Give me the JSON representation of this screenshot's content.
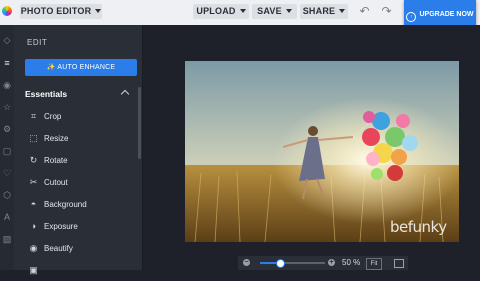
{
  "header": {
    "app_menu_label": "PHOTO EDITOR",
    "upload_label": "UPLOAD",
    "save_label": "SAVE",
    "share_label": "SHARE",
    "upgrade_label": "UPGRADE NOW",
    "undo_icon": "undo-icon",
    "redo_icon": "redo-icon"
  },
  "sidebar_rail": {
    "icons": [
      "layers-icon",
      "adjust-sliders-icon",
      "eye-icon",
      "star-icon",
      "gear-icon",
      "frame-icon",
      "heart-icon",
      "hexagon-icon",
      "text-icon",
      "texture-icon"
    ]
  },
  "panel": {
    "title": "EDIT",
    "auto_enhance_label": "AUTO ENHANCE",
    "section_title": "Essentials",
    "items": [
      {
        "label": "Crop",
        "icon": "crop-icon"
      },
      {
        "label": "Resize",
        "icon": "resize-icon"
      },
      {
        "label": "Rotate",
        "icon": "rotate-icon"
      },
      {
        "label": "Cutout",
        "icon": "scissors-icon"
      },
      {
        "label": "Background",
        "icon": "background-icon"
      },
      {
        "label": "Exposure",
        "icon": "exposure-icon"
      },
      {
        "label": "Beautify",
        "icon": "beautify-icon"
      }
    ]
  },
  "canvas": {
    "watermark": "befunky"
  },
  "zoom": {
    "value_label": "50 %",
    "fit_label": "Fit",
    "level": 0.3
  },
  "colors": {
    "accent": "#2b7de9",
    "panel_bg": "#2a2e37",
    "canvas_bg": "#1e2129",
    "topbar_bg": "#eef0f3"
  }
}
